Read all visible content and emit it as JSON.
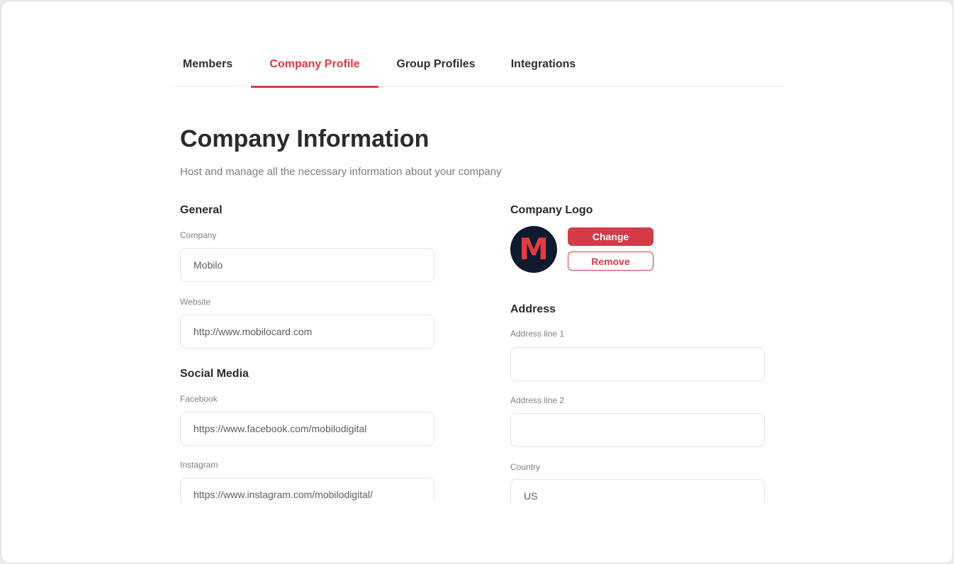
{
  "tabs": [
    {
      "label": "Members",
      "active": false
    },
    {
      "label": "Company Profile",
      "active": true
    },
    {
      "label": "Group Profiles",
      "active": false
    },
    {
      "label": "Integrations",
      "active": false
    }
  ],
  "page": {
    "title": "Company Information",
    "subtitle": "Host and manage all the necessary information about your company"
  },
  "general": {
    "heading": "General",
    "company_label": "Company",
    "company_value": "Mobilo",
    "website_label": "Website",
    "website_value": "http://www.mobilocard.com"
  },
  "social": {
    "heading": "Social Media",
    "facebook_label": "Facebook",
    "facebook_value": "https://www.facebook.com/mobilodigital",
    "instagram_label": "Instagram",
    "instagram_value": "https://www.instagram.com/mobilodigital/"
  },
  "logo": {
    "heading": "Company Logo",
    "letter": "M",
    "change_label": "Change",
    "remove_label": "Remove"
  },
  "address": {
    "heading": "Address",
    "line1_label": "Address line 1",
    "line1_value": "",
    "line2_label": "Address line 2",
    "line2_value": "",
    "country_label": "Country",
    "country_value": "US"
  },
  "colors": {
    "accent": "#d93a45",
    "logo_bg": "#0f1a2e"
  }
}
